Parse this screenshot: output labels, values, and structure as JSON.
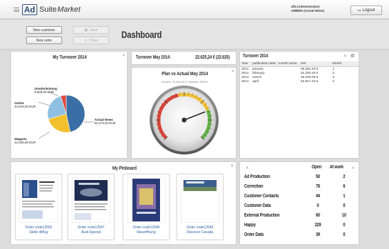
{
  "topbar": {
    "logo_ad": "Ad",
    "logo_suite": "Suite",
    "logo_market": "Market",
    "user_line1": "alfa (Administrator)",
    "user_line2": "AMBMS (Actual News)",
    "logout_label": "Logout"
  },
  "toolbar": {
    "new_customer": "New customer",
    "new_order": "New order",
    "save": "Save",
    "close": "Close",
    "page_title": "Dashboard"
  },
  "turnover_pie": {
    "title": "My Turnover 2014",
    "slices": [
      {
        "label": "Actual News",
        "value_label": "82.473,40 EUR",
        "color": "#3a6fa5",
        "value": 82473.4
      },
      {
        "label": "Magazin",
        "value_label": "42.326,00 EUR",
        "color": "#f2c12e",
        "value": 42326.0
      },
      {
        "label": "Online",
        "value_label": "43.875,00 EUR",
        "color": "#8fc0e3",
        "value": 43875.0
      },
      {
        "label": "Sonderleistung",
        "value_label": "8.529,00 EUR",
        "color": "#e04a3f",
        "value": 8529.0
      }
    ]
  },
  "turnover_month": {
    "label": "Turnover May 2014:",
    "value": "22.625,24 € (22.625)"
  },
  "gauge": {
    "title": "Plan vs Actual May 2014",
    "subtitle": "Current: 22.625,24 €, Planned: 30000",
    "current": 22625.24,
    "planned": 30000
  },
  "turnover_table": {
    "title": "Turnover 2014",
    "headers": [
      "Year",
      "publication date - month name",
      "Net",
      "Month"
    ],
    "rows": [
      [
        "2014",
        "january",
        "86,361.10 €",
        "1"
      ],
      [
        "2014",
        "february",
        "52,283.40 €",
        "2"
      ],
      [
        "2014",
        "march",
        "46,326.05 €",
        "3"
      ],
      [
        "2014",
        "april",
        "52,817.34 €",
        "4"
      ]
    ]
  },
  "pinboard": {
    "title": "My Pinboard",
    "cards": [
      {
        "line1": "Order code12550",
        "line2": "Stelle ditflug"
      },
      {
        "line1": "Order code12547",
        "line2": "Audi-Special"
      },
      {
        "line1": "Order code12548",
        "line2": "Neuerffnung"
      },
      {
        "line1": "Order code12546",
        "line2": "Discover Canada"
      }
    ]
  },
  "stats": {
    "col_open": "Open",
    "col_atwork": "At work",
    "rows": [
      {
        "label": "Ad Production",
        "open": "50",
        "atwork": "2"
      },
      {
        "label": "Correction",
        "open": "78",
        "atwork": "6"
      },
      {
        "label": "Customer Contacts",
        "open": "44",
        "atwork": "1"
      },
      {
        "label": "Customer Data",
        "open": "0",
        "atwork": "0"
      },
      {
        "label": "External Production",
        "open": "60",
        "atwork": "10"
      },
      {
        "label": "Happy",
        "open": "229",
        "atwork": "0"
      },
      {
        "label": "Order Data",
        "open": "39",
        "atwork": "0"
      }
    ]
  }
}
